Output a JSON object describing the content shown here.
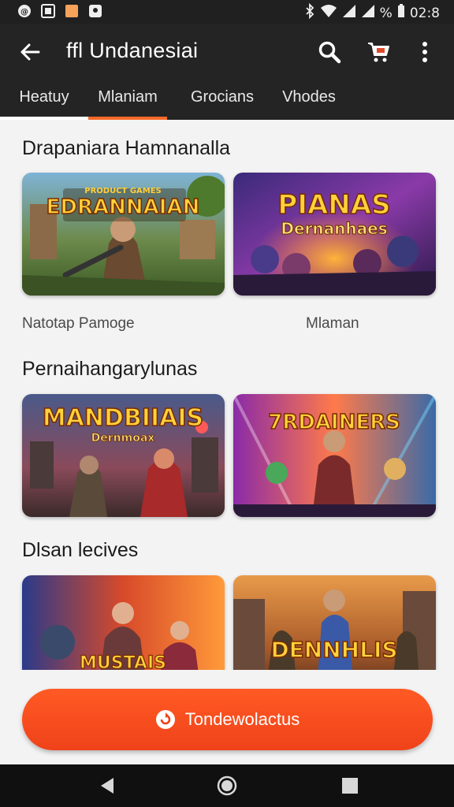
{
  "status_bar": {
    "time": "02:8",
    "battery": "%",
    "icons": [
      "app-icon",
      "gallery-icon",
      "orange-square-icon",
      "notification-icon",
      "bluetooth-icon",
      "wifi-icon",
      "signal-icon",
      "signal-icon"
    ]
  },
  "app_bar": {
    "title": "ffl Undanesiai",
    "icons": [
      "back-arrow-icon",
      "search-icon",
      "cart-icon",
      "more-vert-icon"
    ]
  },
  "tabs": [
    {
      "label": "Heatuy"
    },
    {
      "label": "Mlaniam"
    },
    {
      "label": "Grocians"
    },
    {
      "label": "Vhodes"
    }
  ],
  "sections": [
    {
      "title": "Drapaniara Hamnanalla",
      "cards": [
        {
          "banner": "EDRANNAIAN",
          "banner_top": "PRODUCT GAMES",
          "caption": "Natotap Pamoge"
        },
        {
          "banner": "PIANAS",
          "banner_sub": "Dernanhaes",
          "caption": "Mlaman"
        }
      ]
    },
    {
      "title": "Pernaihangarylunas",
      "cards": [
        {
          "banner": "MANDBIIAIS",
          "banner_sub": "Dernmoax"
        },
        {
          "banner": "7RDAINERS"
        }
      ]
    },
    {
      "title": "Dlsan lecives",
      "cards": [
        {
          "banner": "MUSTAIS"
        },
        {
          "banner": "DENNHLIS"
        }
      ]
    }
  ],
  "cta": {
    "label": "Tondewolactus",
    "color": "#f24c1f"
  },
  "nav": {
    "icons": [
      "back-triangle-icon",
      "home-circle-icon",
      "recents-square-icon"
    ]
  },
  "colors": {
    "bar": "#242424",
    "accent": "#f56a2a"
  }
}
